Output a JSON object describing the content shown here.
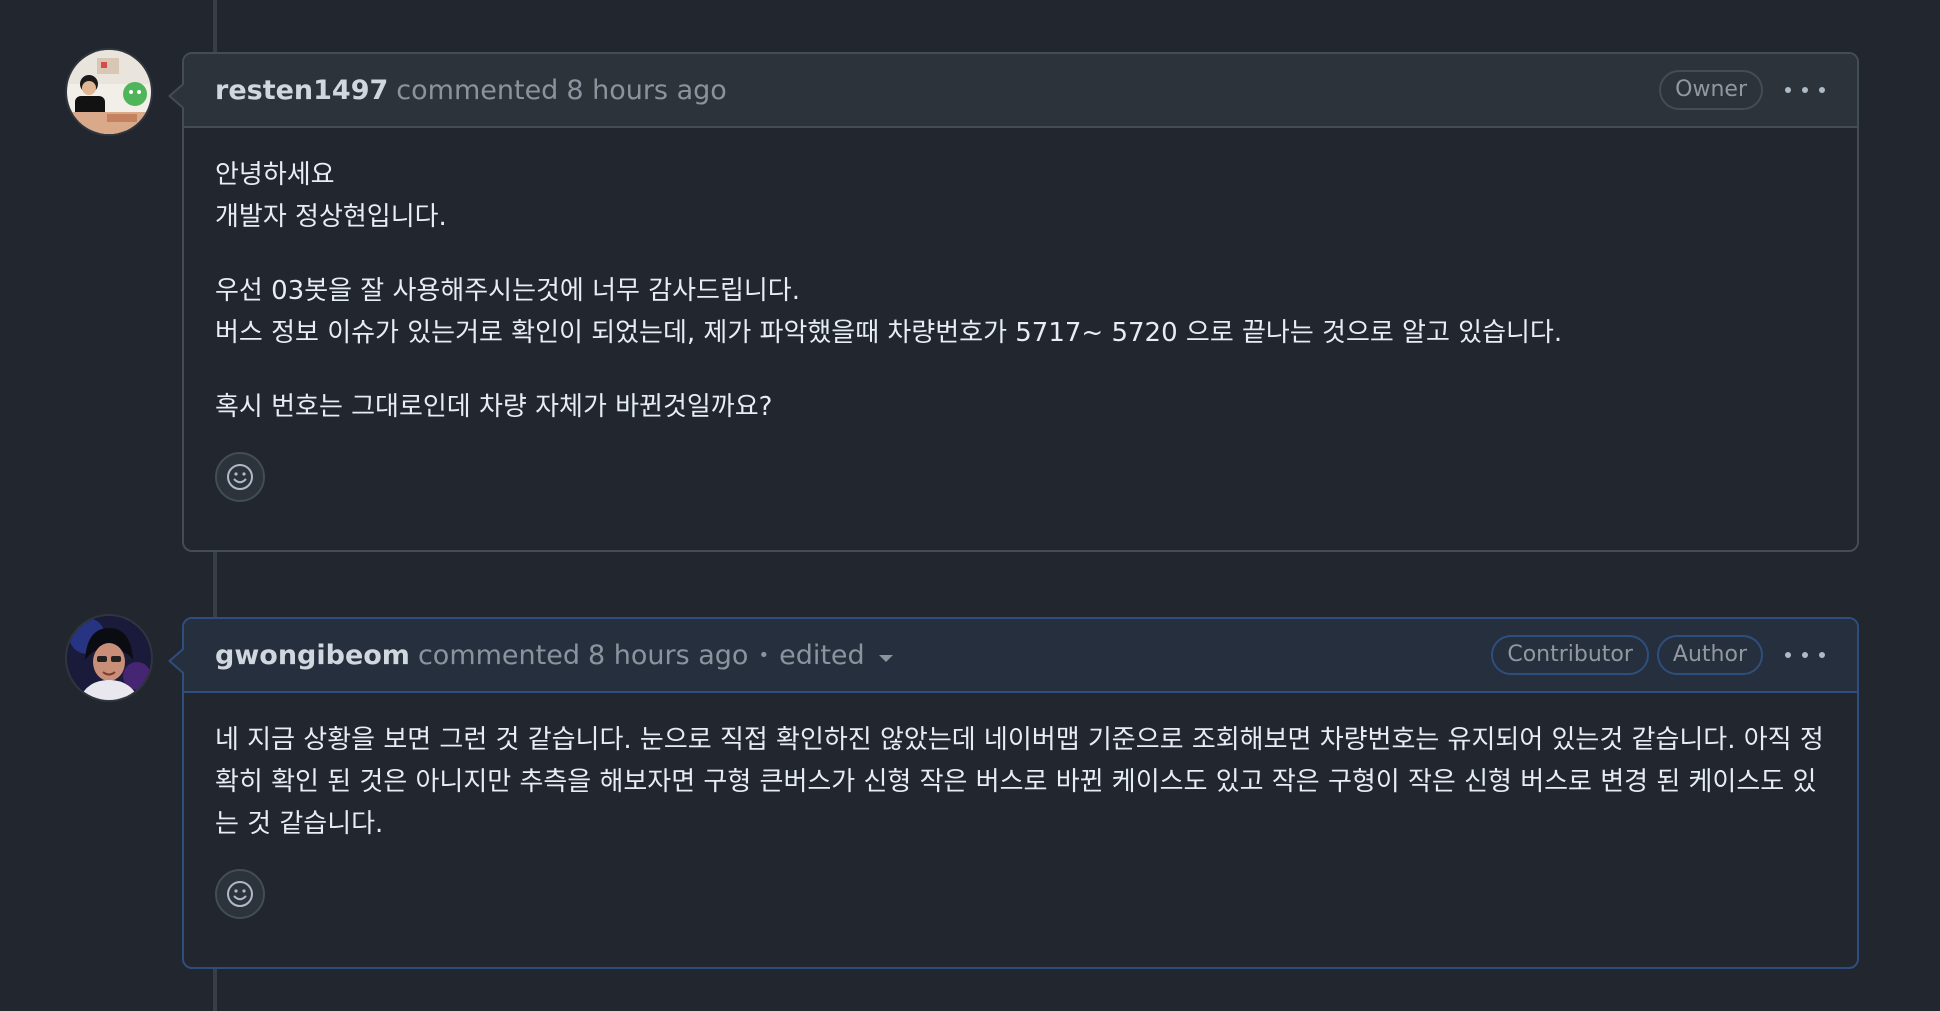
{
  "comments": [
    {
      "username": "resten1497",
      "action": "commented",
      "time": "8 hours ago",
      "badges": [
        "Owner"
      ],
      "paragraphs": [
        [
          "안녕하세요",
          "개발자 정상현입니다."
        ],
        [
          "우선 03봇을 잘 사용해주시는것에 너무 감사드립니다.",
          "버스 정보 이슈가 있는거로 확인이 되었는데, 제가 파악했을때 차량번호가 5717~ 5720 으로 끝나는 것으로 알고 있습니다."
        ],
        [
          "혹시 번호는 그대로인데 차량 자체가 바뀐것일까요?"
        ]
      ]
    },
    {
      "username": "gwongibeom",
      "action": "commented",
      "time": "8 hours ago",
      "edited_label": "edited",
      "badges": [
        "Contributor",
        "Author"
      ],
      "paragraphs": [
        [
          "네 지금 상황을 보면 그런 것 같습니다. 눈으로 직접 확인하진 않았는데 네이버맵 기준으로 조회해보면 차량번호는 유지되어 있는것 같습니다. 아직 정",
          "확히 확인 된 것은 아니지만 추측을 해보자면 구형 큰버스가 신형 작은 버스로 바뀐 케이스도 있고 작은 구형이 작은 신형 버스로 변경 된 케이스도 있",
          "는 것 같습니다."
        ]
      ]
    }
  ],
  "icons": {
    "reaction": "smiley-icon",
    "more": "kebab-horizontal-icon",
    "edited_dropdown": "triangle-down-icon"
  },
  "colors": {
    "background": "#22262e",
    "border": "#444c56",
    "author_border": "#2e4f7e",
    "header_bg": "#2d333b",
    "author_header_bg": "#262f3d"
  }
}
